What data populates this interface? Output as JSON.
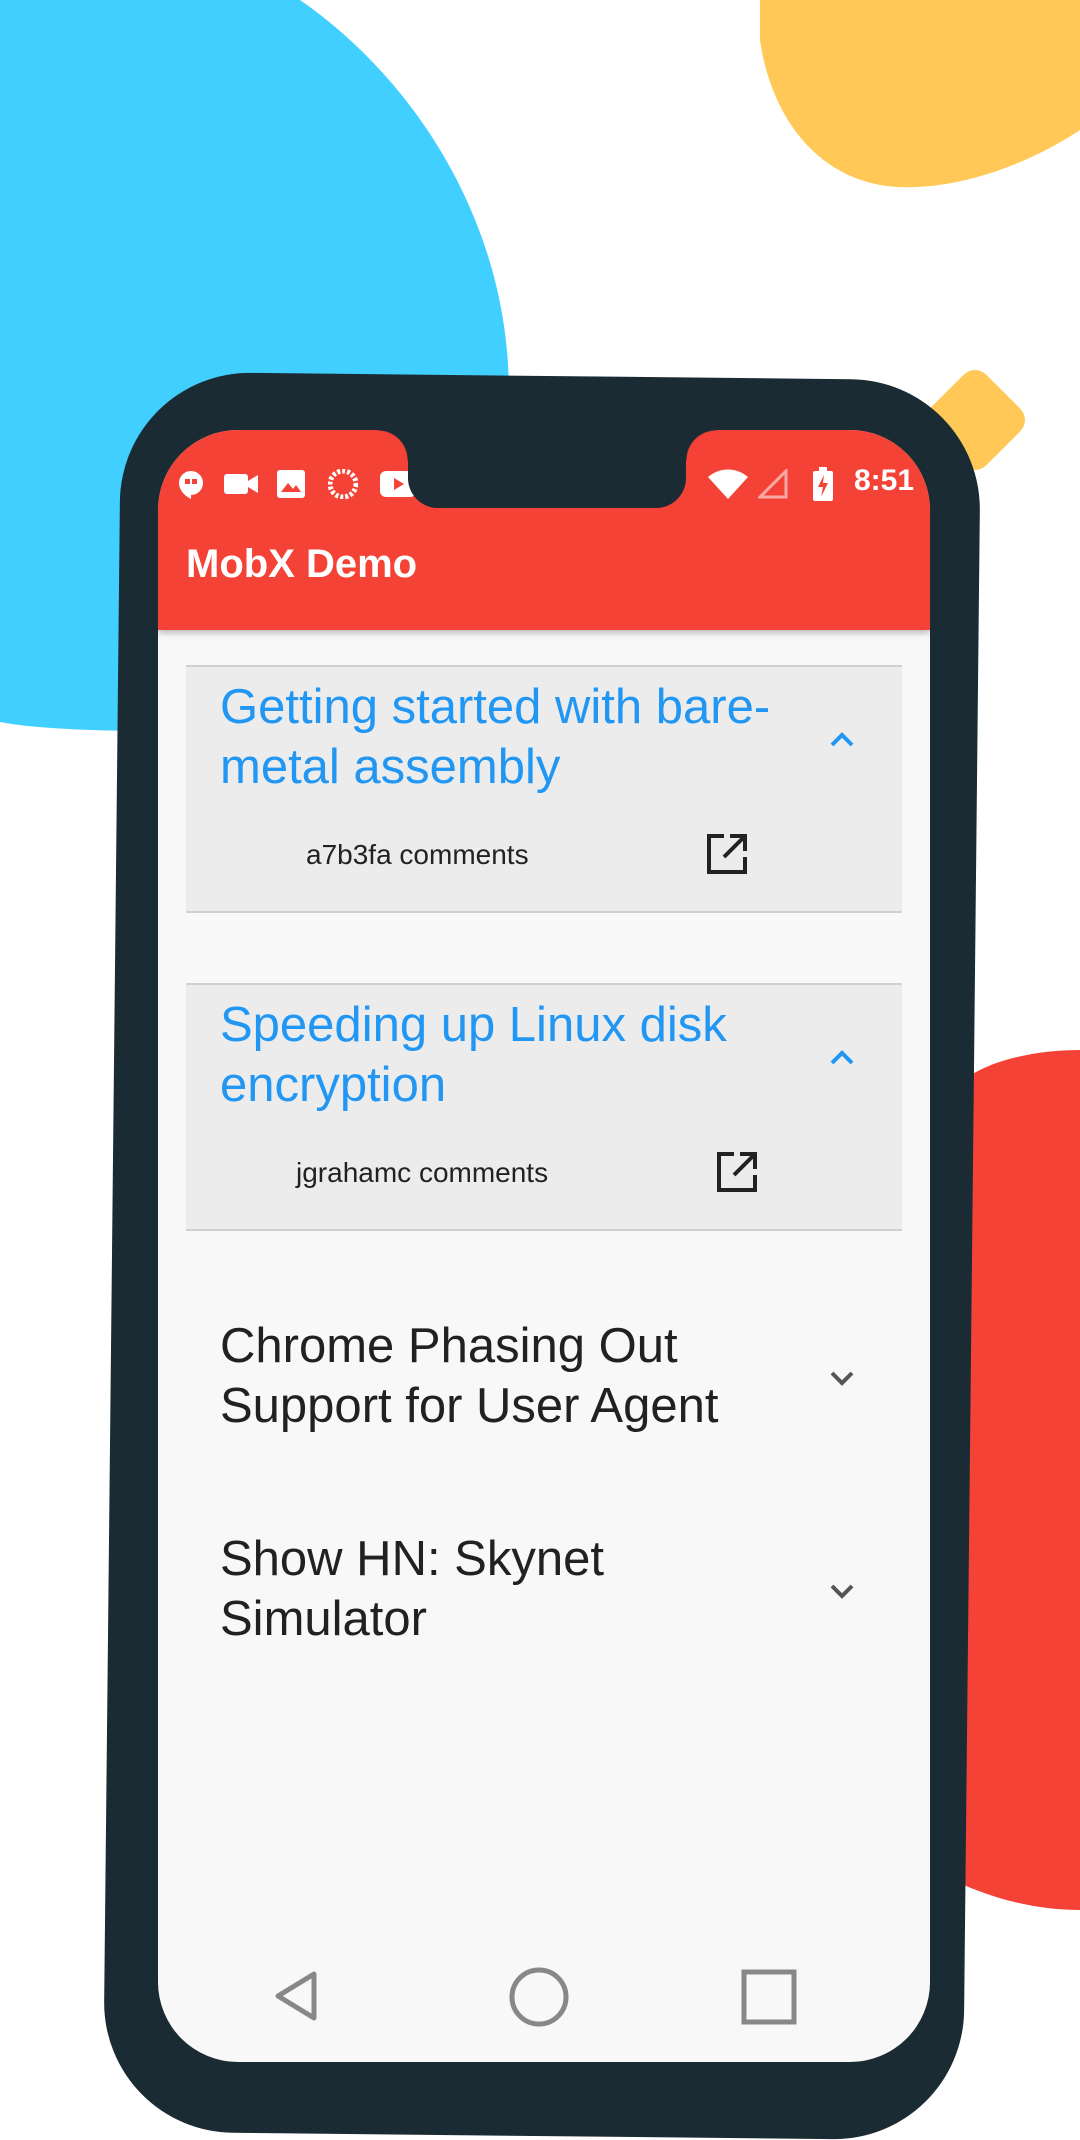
{
  "app": {
    "title": "MobX Demo"
  },
  "status_bar": {
    "time": "8:51",
    "icons": [
      "hangouts-icon",
      "video-camera-icon",
      "image-icon",
      "loading-icon",
      "youtube-icon",
      "wifi-icon",
      "signal-icon",
      "battery-charging-icon"
    ]
  },
  "stories": [
    {
      "title": "Getting started with bare-metal assembly",
      "author_label": "a7b3fa comments",
      "expanded": true
    },
    {
      "title": "Speeding up Linux disk encryption",
      "author_label": "jgrahamc comments",
      "expanded": true
    },
    {
      "title": "Chrome Phasing Out Support for User Agent",
      "expanded": false
    },
    {
      "title": "Show HN: Skynet Simulator",
      "expanded": false
    }
  ],
  "nav_bar": {
    "icons": [
      "back-icon",
      "home-icon",
      "recents-icon"
    ]
  },
  "colors": {
    "accent": "#2196f3",
    "app_bar": "#f44336",
    "frame": "#1b2b33",
    "blob_blue": "#40cfff",
    "blob_yellow": "#ffc857",
    "blob_red": "#f44336"
  }
}
